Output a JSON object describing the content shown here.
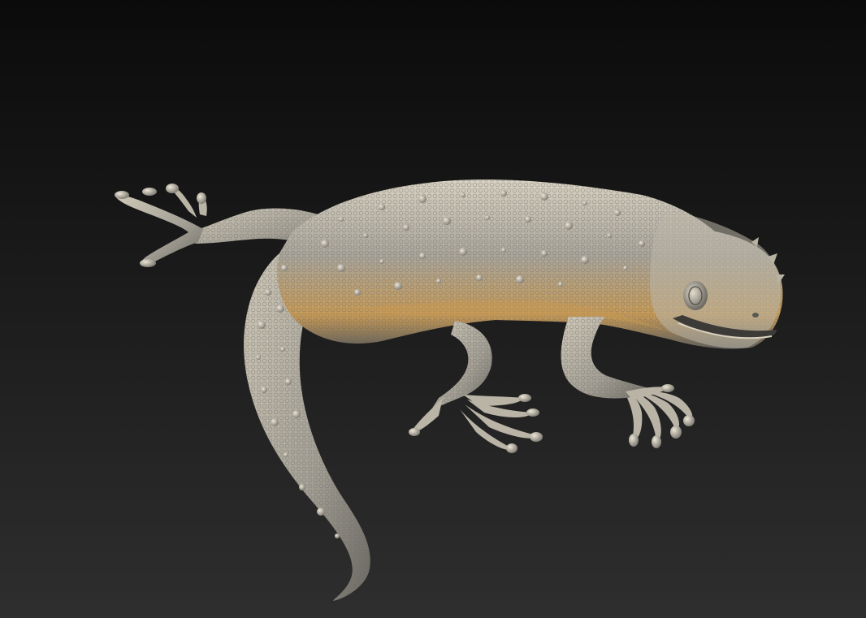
{
  "viewport": {
    "background_top": "#0b0b0b",
    "background_bottom": "#2e2e2e",
    "subject": "gecko-sculpt",
    "material": {
      "base": "#a9a59b",
      "highlight": "#d8d2c2",
      "warm_rim": "#c79a55",
      "shadow": "#5f5e5a"
    }
  }
}
